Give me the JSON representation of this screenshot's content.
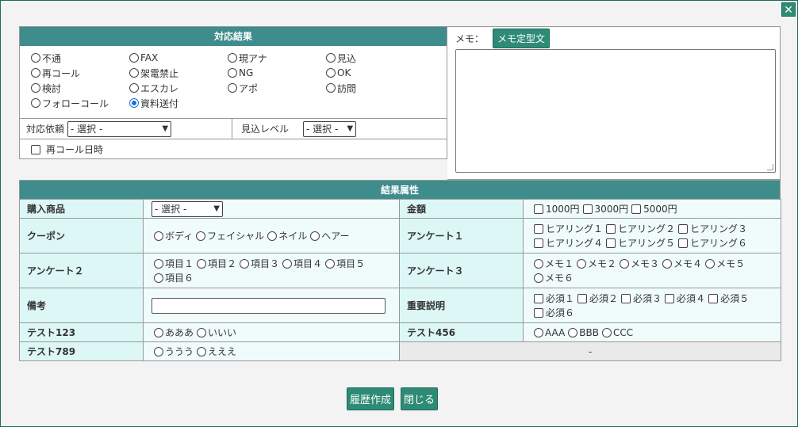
{
  "close_label": "✕",
  "result": {
    "header": "対応結果",
    "radios": [
      {
        "label": "不通",
        "checked": false
      },
      {
        "label": "FAX",
        "checked": false
      },
      {
        "label": "現アナ",
        "checked": false
      },
      {
        "label": "見込",
        "checked": false
      },
      {
        "label": "再コール",
        "checked": false
      },
      {
        "label": "架電禁止",
        "checked": false
      },
      {
        "label": "NG",
        "checked": false
      },
      {
        "label": "OK",
        "checked": false
      },
      {
        "label": "検討",
        "checked": false
      },
      {
        "label": "エスカレ",
        "checked": false
      },
      {
        "label": "アポ",
        "checked": false
      },
      {
        "label": "訪問",
        "checked": false
      },
      {
        "label": "フォローコール",
        "checked": false
      },
      {
        "label": "資料送付",
        "checked": true
      }
    ],
    "request_label": "対応依頼",
    "request_value": "- 選択 -",
    "level_label": "見込レベル",
    "level_value": "- 選択 -",
    "recall_label": "再コール日時"
  },
  "memo": {
    "label": "メモ：",
    "template_button": "メモ定型文"
  },
  "attributes": {
    "header": "結果属性",
    "rows": [
      {
        "left_label": "購入商品",
        "left_type": "select",
        "left_value": "- 選択 -",
        "right_label": "金額",
        "right_type": "checkbox",
        "right_options": [
          "1000円",
          "3000円",
          "5000円"
        ]
      },
      {
        "left_label": "クーポン",
        "left_type": "radio",
        "left_options": [
          "ボディ",
          "フェイシャル",
          "ネイル",
          "ヘアー"
        ],
        "right_label": "アンケート１",
        "right_type": "checkbox",
        "right_options": [
          "ヒアリング１",
          "ヒアリング２",
          "ヒアリング３",
          "ヒアリング４",
          "ヒアリング５",
          "ヒアリング６"
        ]
      },
      {
        "left_label": "アンケート２",
        "left_type": "radio",
        "left_options": [
          "項目１",
          "項目２",
          "項目３",
          "項目４",
          "項目５",
          "項目６"
        ],
        "right_label": "アンケート３",
        "right_type": "radio",
        "right_options": [
          "メモ１",
          "メモ２",
          "メモ３",
          "メモ４",
          "メモ５",
          "メモ６"
        ]
      },
      {
        "left_label": "備考",
        "left_type": "text",
        "right_label": "重要説明",
        "right_type": "checkbox",
        "right_options": [
          "必須１",
          "必須２",
          "必須３",
          "必須４",
          "必須５",
          "必須６"
        ]
      },
      {
        "left_label": "テスト123",
        "left_type": "radio",
        "left_options": [
          "あああ",
          "いいい"
        ],
        "right_label": "テスト456",
        "right_type": "radio",
        "right_options": [
          "AAA",
          "BBB",
          "CCC"
        ]
      },
      {
        "left_label": "テスト789",
        "left_type": "radio",
        "left_options": [
          "ううう",
          "えええ"
        ],
        "right_label": "",
        "right_type": "empty",
        "right_text": "-"
      }
    ]
  },
  "footer": {
    "history_button": "履歴作成",
    "close_button": "閉じる"
  }
}
